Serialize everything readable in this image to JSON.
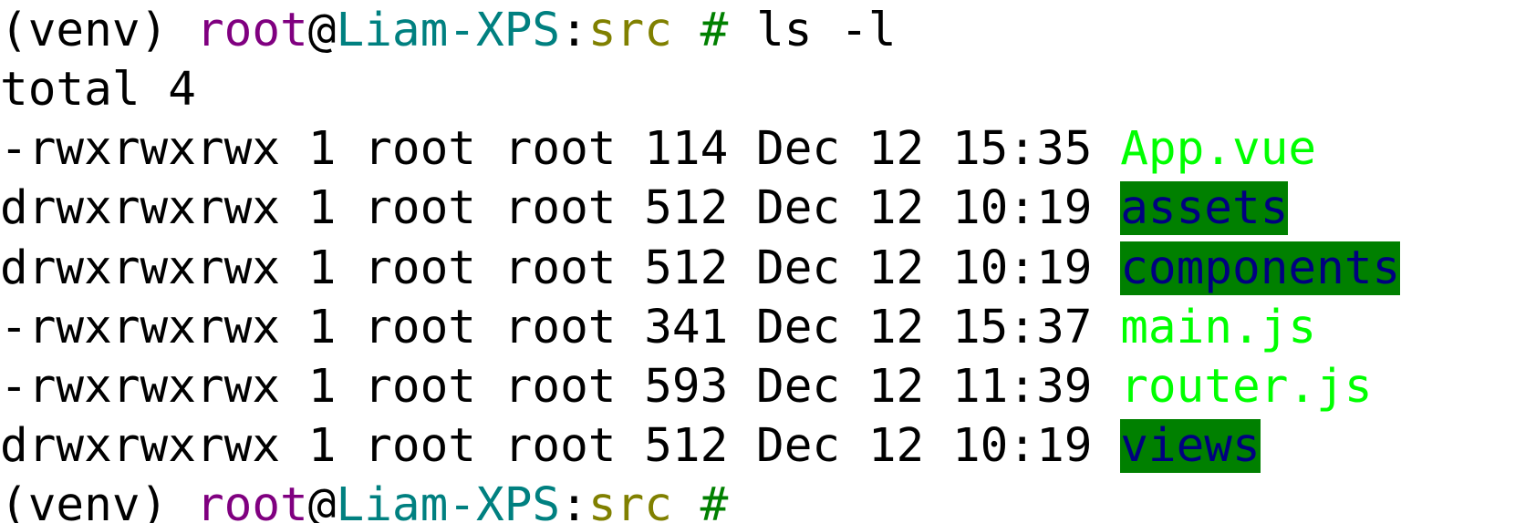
{
  "prompt": {
    "venv": "(venv) ",
    "user": "root",
    "at": "@",
    "host": "Liam-XPS",
    "colon": ":",
    "path": "src",
    "hash": " #",
    "command": " ls -l"
  },
  "total_line": "total 4",
  "entries": [
    {
      "meta": "-rwxrwxrwx 1 root root 114 Dec 12 15:35 ",
      "name": "App.vue",
      "kind": "executable-file"
    },
    {
      "meta": "drwxrwxrwx 1 root root 512 Dec 12 10:19 ",
      "name": "assets",
      "kind": "directory"
    },
    {
      "meta": "drwxrwxrwx 1 root root 512 Dec 12 10:19 ",
      "name": "components",
      "kind": "directory"
    },
    {
      "meta": "-rwxrwxrwx 1 root root 341 Dec 12 15:37 ",
      "name": "main.js",
      "kind": "executable-file"
    },
    {
      "meta": "-rwxrwxrwx 1 root root 593 Dec 12 11:39 ",
      "name": "router.js",
      "kind": "executable-file"
    },
    {
      "meta": "drwxrwxrwx 1 root root 512 Dec 12 10:19 ",
      "name": "views",
      "kind": "directory"
    }
  ],
  "next_prompt": {
    "venv": "(venv) ",
    "user": "root",
    "at": "@",
    "host": "Liam-XPS",
    "colon": ":",
    "path": "src",
    "hash": " #"
  },
  "colors": {
    "background": "#ffffff",
    "text": "#000000",
    "user": "#800080",
    "host": "#008080",
    "path": "#808000",
    "prompt_symbol": "#008000",
    "executable_file": "#00ff00",
    "directory_text": "#000080",
    "directory_background": "#008000"
  }
}
